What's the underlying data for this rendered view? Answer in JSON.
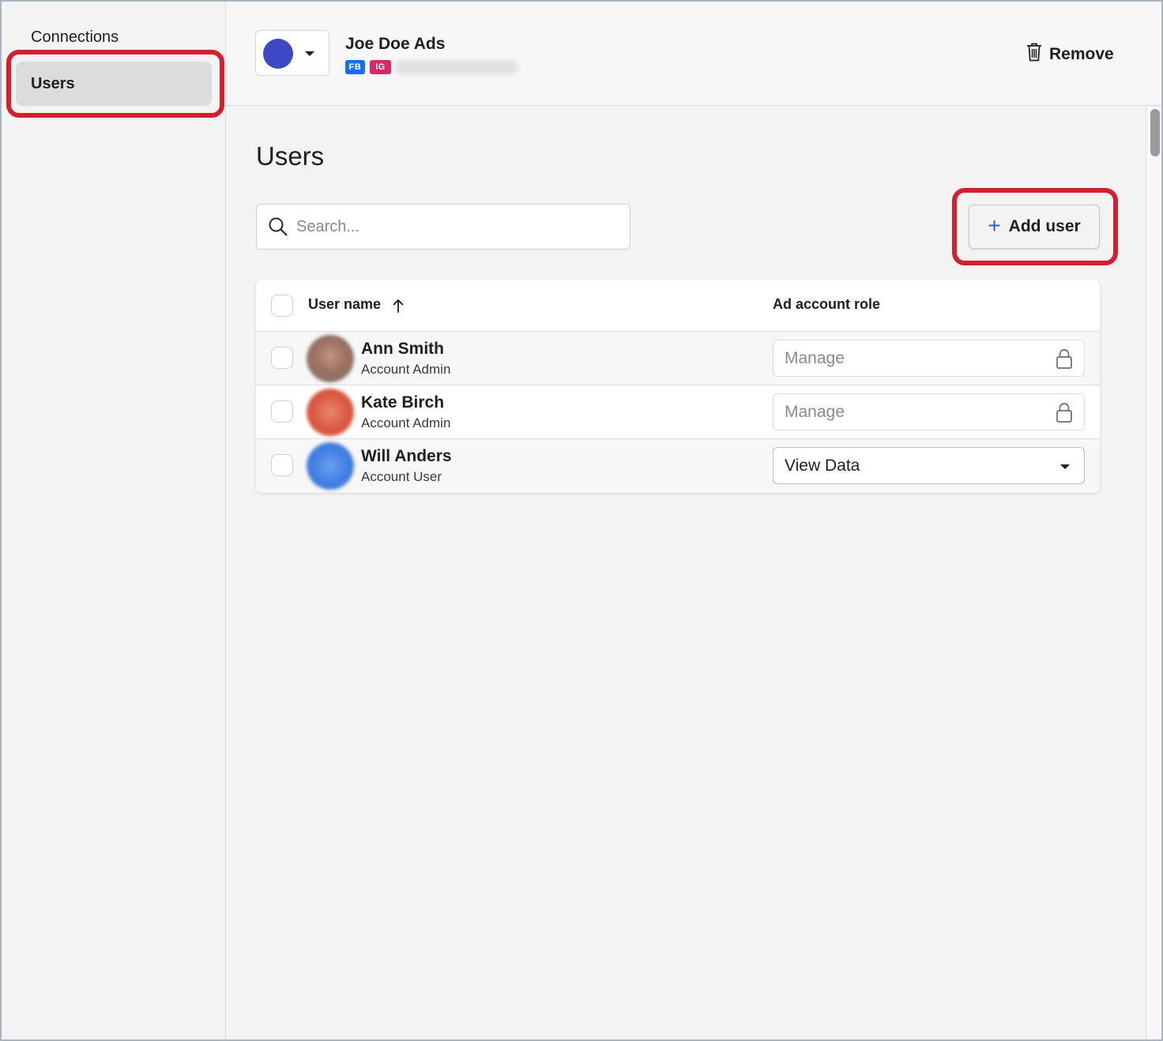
{
  "sidebar": {
    "items": [
      {
        "label": "Connections",
        "active": false
      },
      {
        "label": "Users",
        "active": true
      }
    ]
  },
  "header": {
    "account_name": "Joe Doe Ads",
    "account_color": "#3f48c4",
    "badges": [
      "FB",
      "IG"
    ],
    "remove_label": "Remove"
  },
  "main": {
    "title": "Users",
    "search": {
      "placeholder": "Search...",
      "value": ""
    },
    "add_user_label": "Add user",
    "table": {
      "columns": [
        "User name",
        "Ad account role"
      ],
      "sort": {
        "column": "User name",
        "direction": "ascending"
      },
      "rows": [
        {
          "name": "Ann Smith",
          "account_role": "Account Admin",
          "ad_account_role": "Manage",
          "locked": true,
          "avatar_color": "#9c7060"
        },
        {
          "name": "Kate Birch",
          "account_role": "Account Admin",
          "ad_account_role": "Manage",
          "locked": true,
          "avatar_color": "#d9573f"
        },
        {
          "name": "Will Anders",
          "account_role": "Account User",
          "ad_account_role": "View Data",
          "locked": false,
          "avatar_color": "#3e7ee2"
        }
      ]
    }
  },
  "colors": {
    "highlight": "#d31f2e",
    "fb_badge": "#1a6cf0",
    "ig_badge": "#d8266a",
    "plus_accent": "#2a5bd7"
  }
}
